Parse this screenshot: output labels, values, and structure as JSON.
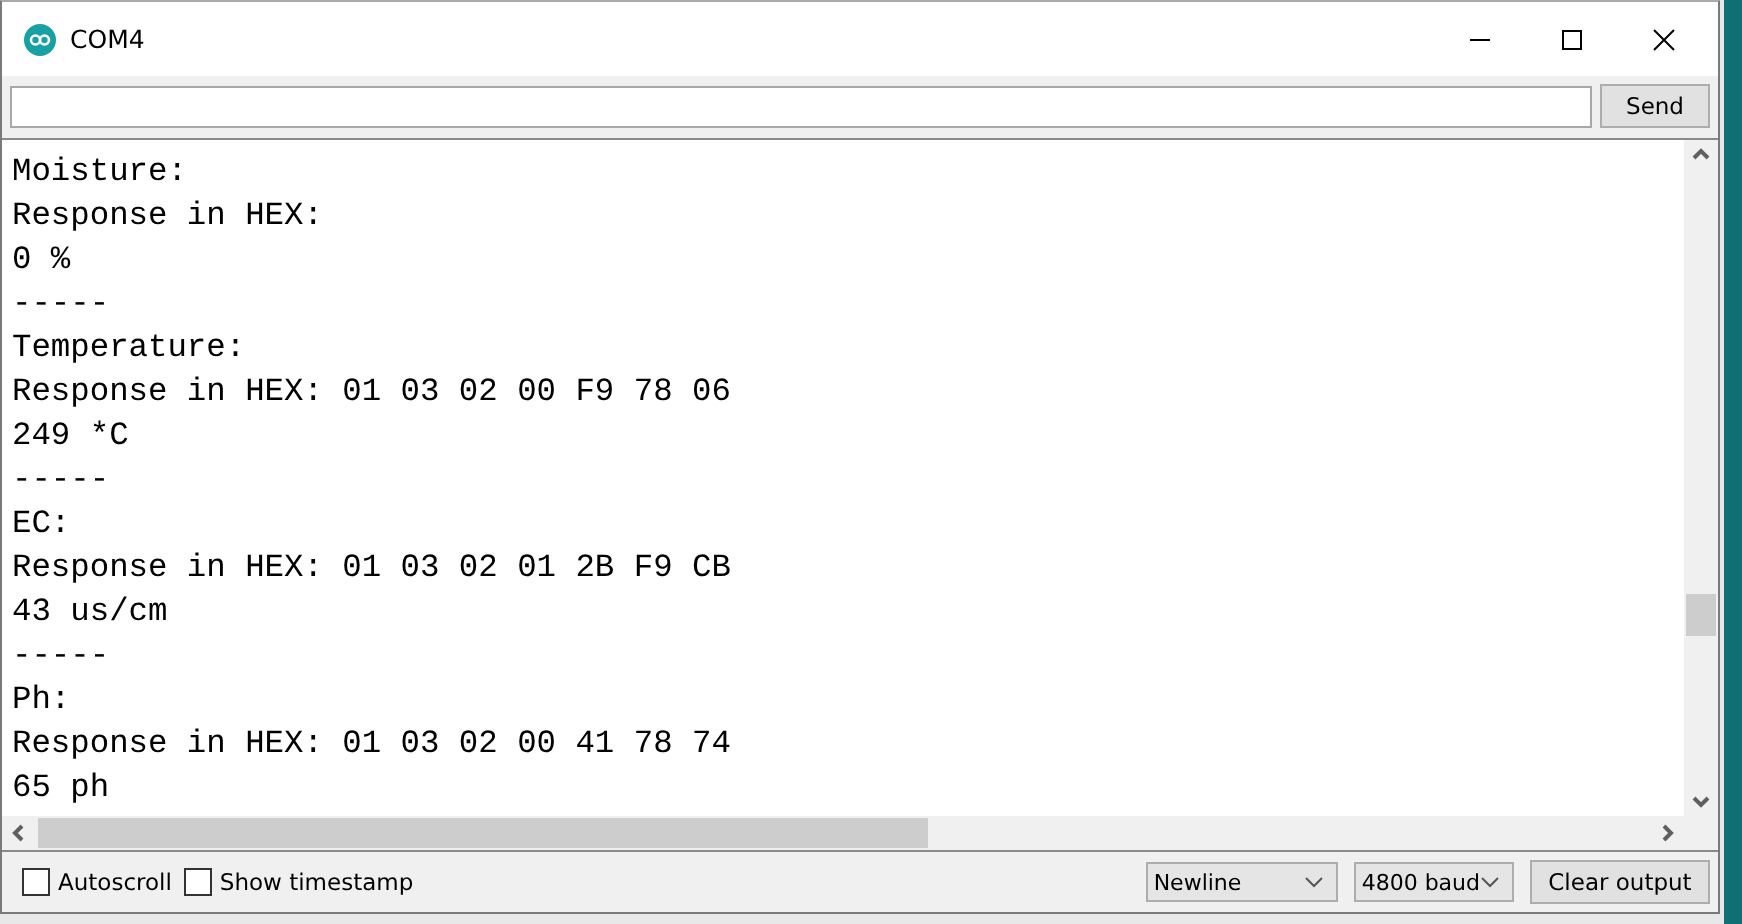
{
  "window": {
    "title": "COM4"
  },
  "send_button": "Send",
  "output_lines": [
    "Moisture:",
    "Response in HEX:",
    "0 %",
    "-----",
    "Temperature:",
    "Response in HEX: 01 03 02 00 F9 78 06",
    "249 *C",
    "-----",
    "EC:",
    "Response in HEX: 01 03 02 01 2B F9 CB",
    "43 us/cm",
    "-----",
    "Ph:",
    "Response in HEX: 01 03 02 00 41 78 74",
    "65 ph"
  ],
  "options": [
    {
      "label": "Autoscroll",
      "checked": false
    },
    {
      "label": "Show timestamp",
      "checked": false
    }
  ],
  "line_ending": "Newline",
  "baud_rate": "4800 baud",
  "clear_button": "Clear output"
}
